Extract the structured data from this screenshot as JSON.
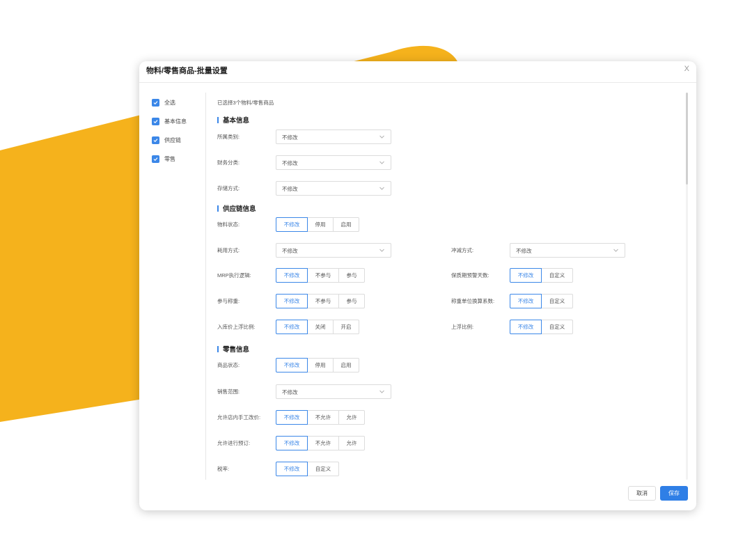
{
  "colors": {
    "accent": "#3b87e8",
    "banner": "#f5b21c",
    "save_button": "#2f7fe6"
  },
  "dialog": {
    "title": "物料/零售商品-批量设置",
    "close_label": "X"
  },
  "sidebar": {
    "items": [
      {
        "label": "全选",
        "checked": true
      },
      {
        "label": "基本信息",
        "checked": true
      },
      {
        "label": "供应链",
        "checked": true
      },
      {
        "label": "零售",
        "checked": true
      }
    ]
  },
  "content": {
    "selected_count": "已选择3个物料/零售商品",
    "basic": {
      "title": "基本信息",
      "category": {
        "label": "所属类别:",
        "value": "不修改"
      },
      "finance": {
        "label": "财务分类:",
        "value": "不修改"
      },
      "storage": {
        "label": "存储方式:",
        "value": "不修改"
      }
    },
    "supply": {
      "title": "供应链信息",
      "material_status": {
        "label": "物料状态:",
        "options": [
          "不修改",
          "停用",
          "启用"
        ],
        "selected": 0
      },
      "usage_mode": {
        "label": "耗用方式:",
        "value": "不修改"
      },
      "offset_mode": {
        "label": "冲减方式:",
        "value": "不修改"
      },
      "mrp": {
        "label": "MRP执行逻辑:",
        "options": [
          "不修改",
          "不参与",
          "参与"
        ],
        "selected": 0
      },
      "shelf_warning": {
        "label": "保质期预警天数:",
        "options": [
          "不修改",
          "自定义"
        ],
        "selected": 0
      },
      "weighing": {
        "label": "参与称重:",
        "options": [
          "不修改",
          "不参与",
          "参与"
        ],
        "selected": 0
      },
      "weigh_unit_factor": {
        "label": "称重单位换算系数:",
        "options": [
          "不修改",
          "自定义"
        ],
        "selected": 0
      },
      "inbound_float": {
        "label": "入库价上浮比例:",
        "options": [
          "不修改",
          "关闭",
          "开启"
        ],
        "selected": 0
      },
      "float_ratio": {
        "label": "上浮比例:",
        "options": [
          "不修改",
          "自定义"
        ],
        "selected": 0
      }
    },
    "retail": {
      "title": "零售信息",
      "goods_status": {
        "label": "商品状态:",
        "options": [
          "不修改",
          "停用",
          "启用"
        ],
        "selected": 0
      },
      "sales_scope": {
        "label": "销售范围:",
        "value": "不修改"
      },
      "manual_price": {
        "label": "允许店内手工改价:",
        "options": [
          "不修改",
          "不允许",
          "允许"
        ],
        "selected": 0
      },
      "reservation": {
        "label": "允许进行预订:",
        "options": [
          "不修改",
          "不允许",
          "允许"
        ],
        "selected": 0
      },
      "tax_rate": {
        "label": "税率:",
        "options": [
          "不修改",
          "自定义"
        ],
        "selected": 0
      }
    }
  },
  "footer": {
    "cancel_label": "取消",
    "save_label": "保存"
  }
}
